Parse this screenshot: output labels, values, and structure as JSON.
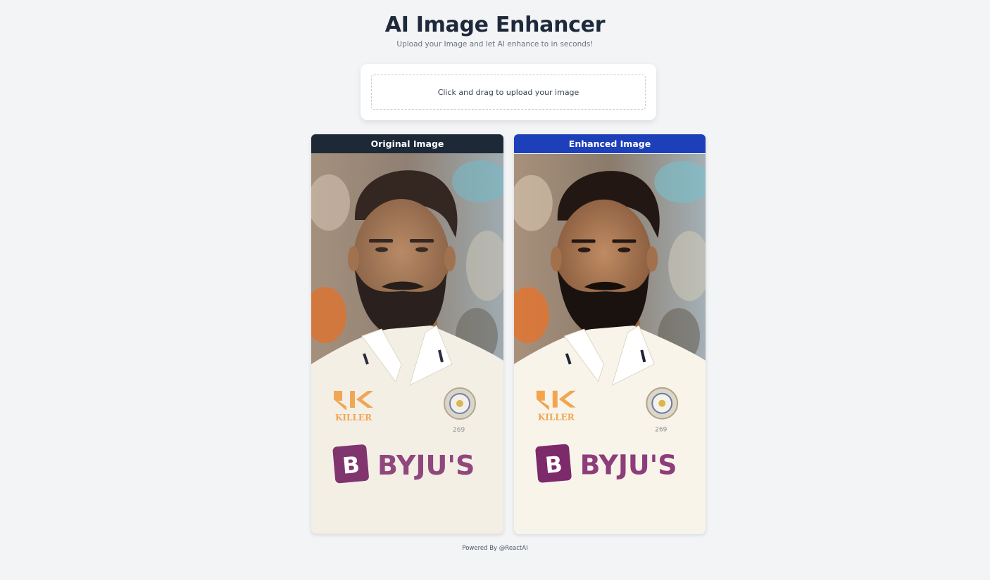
{
  "app": {
    "title": "AI Image Enhancer",
    "subtitle": "Upload your Image and let AI enhance to in seconds!"
  },
  "upload": {
    "prompt": "Click and drag to upload your image"
  },
  "panels": [
    {
      "label": "Original Image",
      "style": "original",
      "header_color": "#1e2937"
    },
    {
      "label": "Enhanced Image",
      "style": "enhanced",
      "header_color": "#1d3fba"
    }
  ],
  "photo": {
    "shirt_logo_brand": "KILLER",
    "shirt_number": "269",
    "sponsor": "BYJU'S",
    "sponsor_mark": "B"
  },
  "footer": {
    "credit": "Powered By @ReactAI"
  }
}
